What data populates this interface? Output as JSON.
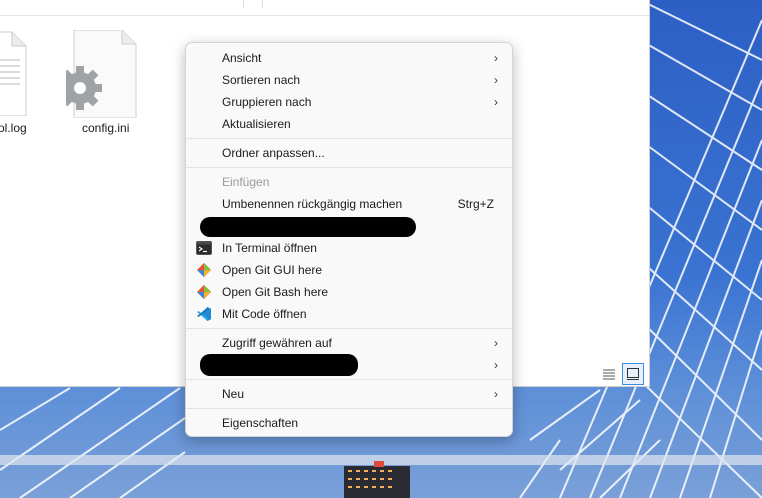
{
  "files": [
    {
      "label": "ol.log",
      "icon": "text-file-icon"
    },
    {
      "label": "config.ini",
      "icon": "settings-file-icon"
    }
  ],
  "context_menu": {
    "items": [
      {
        "label": "Ansicht",
        "submenu": true
      },
      {
        "label": "Sortieren nach",
        "submenu": true
      },
      {
        "label": "Gruppieren nach",
        "submenu": true
      },
      {
        "label": "Aktualisieren"
      },
      {
        "label": "Ordner anpassen..."
      },
      {
        "label": "Einfügen",
        "disabled": true
      },
      {
        "label": "Umbenennen rückgängig machen",
        "shortcut": "Strg+Z"
      },
      {
        "label": "In Terminal öffnen",
        "icon": "terminal-icon"
      },
      {
        "label": "Open Git GUI here",
        "icon": "git-gui-icon"
      },
      {
        "label": "Open Git Bash here",
        "icon": "git-bash-icon"
      },
      {
        "label": "Mit Code öffnen",
        "icon": "vscode-icon"
      },
      {
        "label": "Zugriff gewähren auf",
        "submenu": true
      },
      {
        "label": "Neu",
        "submenu": true
      },
      {
        "label": "Eigenschaften"
      }
    ],
    "chevron": "›"
  },
  "colors": {
    "wallpaper": "#2f62c4",
    "vscode_blue": "#1f8ad2",
    "git_orange": "#f05133",
    "active_view_border": "#3b8de0"
  }
}
